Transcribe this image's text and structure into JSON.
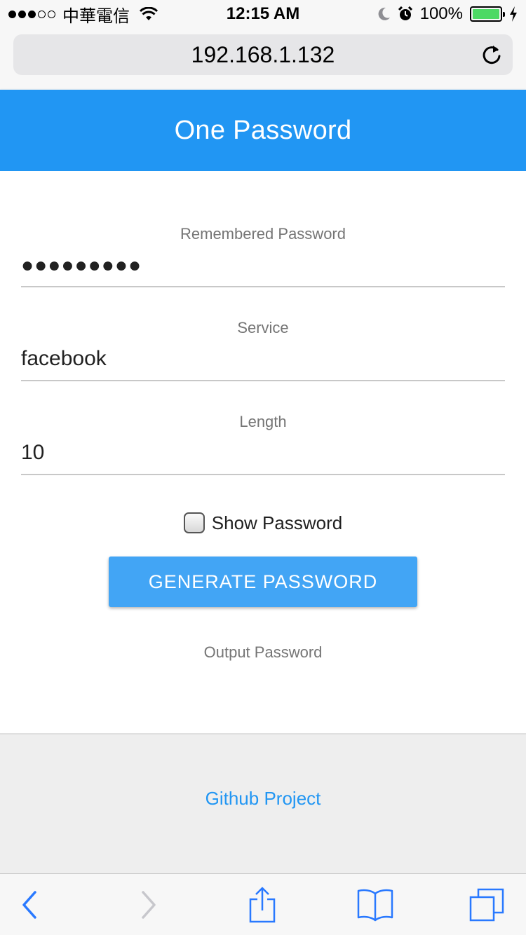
{
  "status_bar": {
    "carrier": "中華電信",
    "time": "12:15 AM",
    "battery": "100%",
    "icons": [
      "signal-dots-icon",
      "wifi-icon",
      "moon-icon",
      "alarm-icon",
      "battery-icon",
      "charging-bolt-icon"
    ]
  },
  "browser": {
    "url": "192.168.1.132",
    "reload_icon": "reload-icon"
  },
  "header": {
    "title": "One Password",
    "color": "#2196f3"
  },
  "form": {
    "remembered_password": {
      "label": "Remembered Password",
      "value": "●●●●●●●●●"
    },
    "service": {
      "label": "Service",
      "value": "facebook"
    },
    "length": {
      "label": "Length",
      "value": "10"
    },
    "show_password": {
      "label": "Show Password",
      "checked": false
    },
    "generate_button": "GENERATE PASSWORD",
    "output_label": "Output Password"
  },
  "footer": {
    "link": "Github Project",
    "link_color": "#2196f3"
  },
  "toolbar": {
    "icons": [
      "back-icon",
      "forward-icon",
      "share-icon",
      "bookmarks-icon",
      "tabs-icon"
    ]
  }
}
